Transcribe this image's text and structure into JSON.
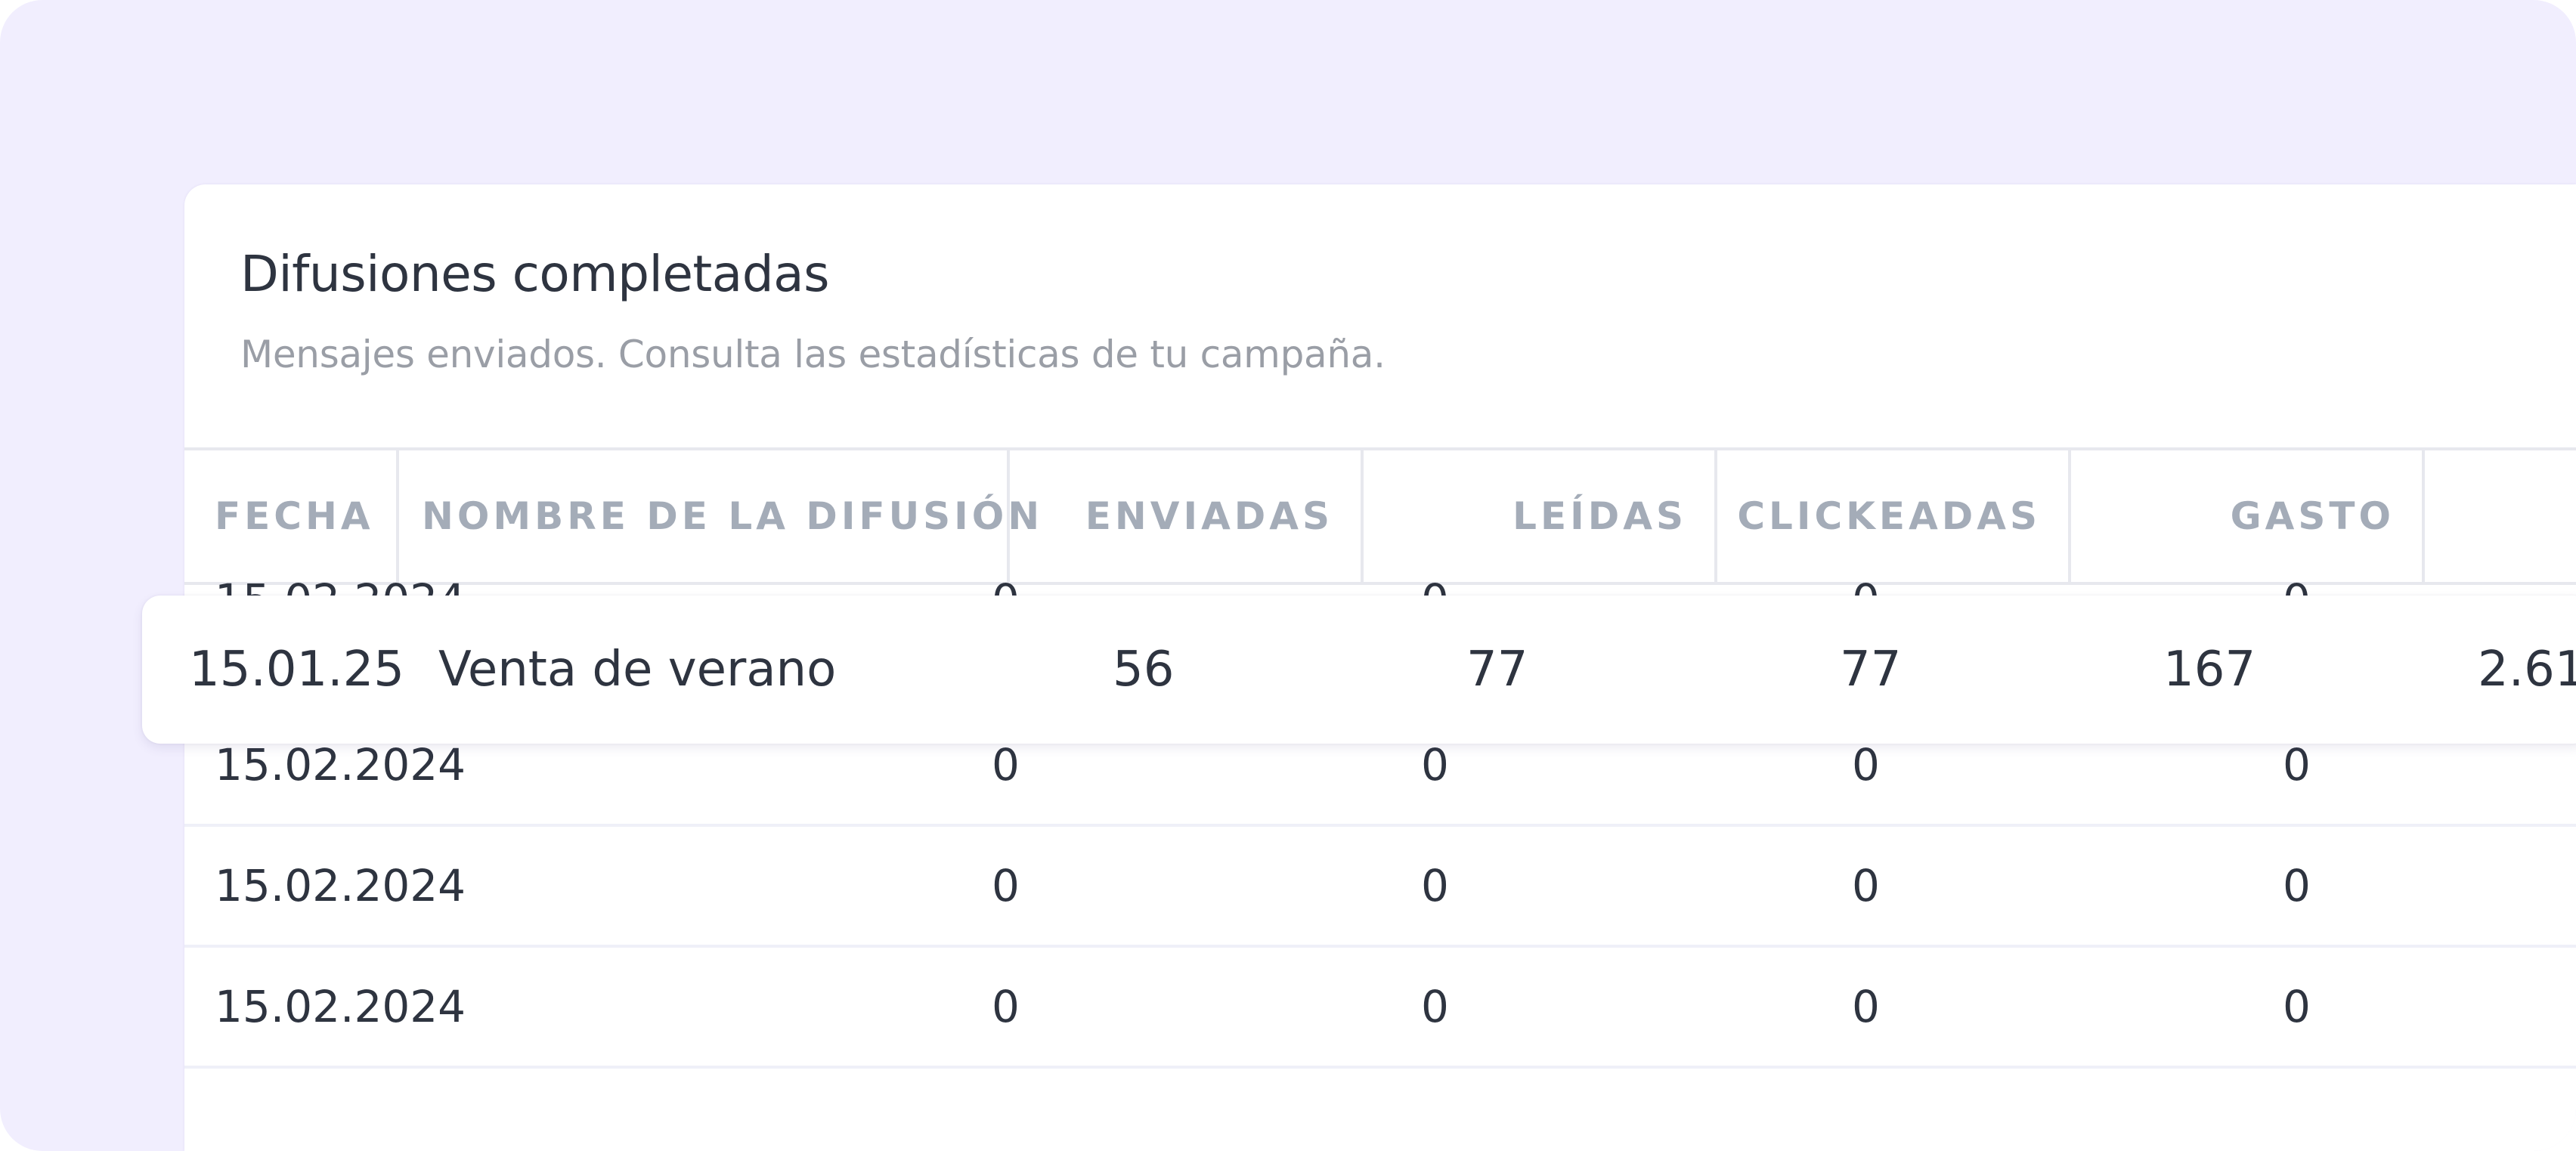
{
  "card": {
    "title": "Difusiones completadas",
    "subtitle": "Mensajes enviados. Consulta las estadísticas de tu campaña."
  },
  "table": {
    "columns": [
      "FECHA",
      "NOMBRE DE LA DIFUSIÓN",
      "ENVIADAS",
      "LEÍDAS",
      "CLICKEADAS",
      "GASTO"
    ],
    "highlighted_row": {
      "date": "15.01.25",
      "name": "Venta de verano",
      "sent": "56",
      "read": "77",
      "clicked": "77",
      "spend": "167",
      "extra": "2.61"
    },
    "rows": [
      {
        "date": "15.02.2024",
        "sent": "0",
        "read": "0",
        "clicked": "0",
        "spend": "0"
      },
      {
        "date": "15.02.2024",
        "sent": "0",
        "read": "0",
        "clicked": "0",
        "spend": "0"
      },
      {
        "date": "15.02.2024",
        "sent": "0",
        "read": "0",
        "clicked": "0",
        "spend": "0"
      },
      {
        "date": "15.02.2024",
        "sent": "0",
        "read": "0",
        "clicked": "0",
        "spend": "0"
      }
    ]
  },
  "colors": {
    "backdrop": "#f1eefe",
    "card": "#ffffff",
    "text": "#2e3440",
    "muted": "#9a9ea6",
    "header": "#a4acb8",
    "border": "#e7e8ee"
  }
}
